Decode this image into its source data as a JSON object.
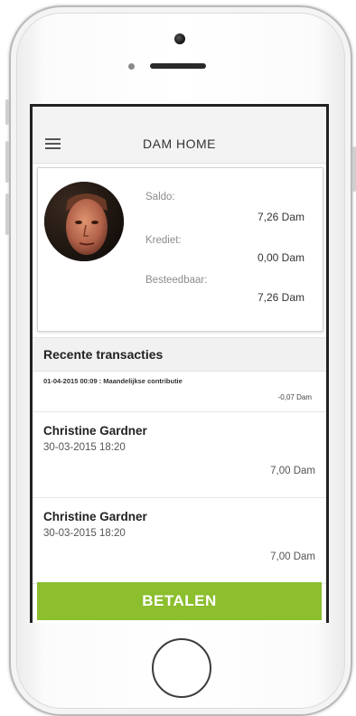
{
  "app": {
    "title": "DAM HOME"
  },
  "balance": {
    "saldo_label": "Saldo:",
    "saldo_value": "7,26 Dam",
    "krediet_label": "Krediet:",
    "krediet_value": "0,00 Dam",
    "besteedbaar_label": "Besteedbaar:",
    "besteedbaar_value": "7,26 Dam"
  },
  "transactions": {
    "heading": "Recente transacties",
    "items": [
      {
        "description": "01-04-2015 00:09 : Maandelijkse contributie",
        "amount": "-0,07 Dam"
      },
      {
        "name": "Christine Gardner",
        "date": "30-03-2015 18:20",
        "amount": "7,00 Dam"
      },
      {
        "name": "Christine Gardner",
        "date": "30-03-2015 18:20",
        "amount": "7,00 Dam"
      }
    ]
  },
  "actions": {
    "pay_label": "BETALEN"
  },
  "icons": {
    "menu": "hamburger-menu-icon",
    "avatar": "user-avatar"
  },
  "colors": {
    "accent": "#8cbe2e",
    "header_bg": "#f3f3f3"
  }
}
